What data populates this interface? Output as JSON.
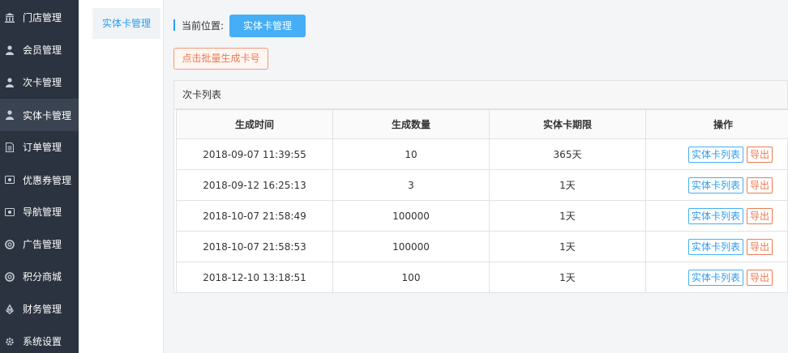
{
  "sidebar": {
    "items": [
      {
        "label": "门店管理",
        "icon": "bank-icon"
      },
      {
        "label": "会员管理",
        "icon": "user-icon"
      },
      {
        "label": "次卡管理",
        "icon": "user-icon"
      },
      {
        "label": "实体卡管理",
        "icon": "user-icon"
      },
      {
        "label": "订单管理",
        "icon": "document-icon"
      },
      {
        "label": "优惠券管理",
        "icon": "ticket-icon"
      },
      {
        "label": "导航管理",
        "icon": "ticket-icon"
      },
      {
        "label": "广告管理",
        "icon": "lifebuoy-icon"
      },
      {
        "label": "积分商城",
        "icon": "lifebuoy-icon"
      },
      {
        "label": "财务管理",
        "icon": "recycle-icon"
      },
      {
        "label": "系统设置",
        "icon": "gear-icon"
      }
    ]
  },
  "subnav": {
    "active_label": "实体卡管理"
  },
  "breadcrumb": {
    "label": "当前位置:",
    "current": "实体卡管理"
  },
  "toolbar": {
    "generate_label": "点击批量生成卡号"
  },
  "panel": {
    "title": "次卡列表"
  },
  "table": {
    "headers": [
      "生成时间",
      "生成数量",
      "实体卡期限",
      "操作"
    ],
    "rows": [
      {
        "time": "2018-09-07 11:39:55",
        "count": "10",
        "term": "365天"
      },
      {
        "time": "2018-09-12 16:25:13",
        "count": "3",
        "term": "1天"
      },
      {
        "time": "2018-10-07 21:58:49",
        "count": "100000",
        "term": "1天"
      },
      {
        "time": "2018-10-07 21:58:53",
        "count": "100000",
        "term": "1天"
      },
      {
        "time": "2018-12-10 13:18:51",
        "count": "100",
        "term": "1天"
      }
    ],
    "actions": {
      "list_label": "实体卡列表",
      "export_label": "导出"
    }
  },
  "colors": {
    "sidebar_bg": "#2b3340",
    "accent_blue": "#45aef6",
    "accent_orange": "#ee7a51"
  }
}
